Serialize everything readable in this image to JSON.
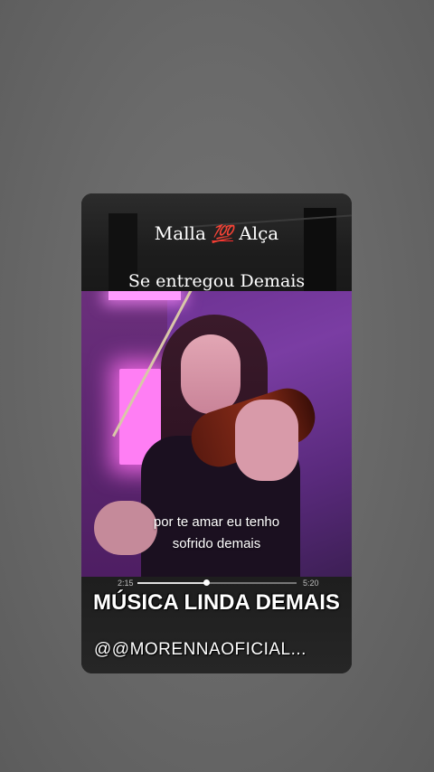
{
  "overlay": {
    "line1_left": "Malla",
    "line1_emoji": "💯",
    "line1_right": "Alça",
    "line2": "Se entregou Demais"
  },
  "video": {
    "subtitle_line1": "por te amar eu tenho",
    "subtitle_line2": "sofrido demais",
    "time_elapsed": "2:15",
    "time_total": "5:20",
    "progress": 0.43
  },
  "caption": {
    "heading": "MÚSICA LINDA DEMAIS",
    "handle": "@@MORENNAOFICIAL..."
  },
  "colors": {
    "background": "#6b6b6b",
    "video_tint": "#7a3da3",
    "neon_light": "#ff7ef4",
    "emoji_red": "#ff2d2d"
  }
}
